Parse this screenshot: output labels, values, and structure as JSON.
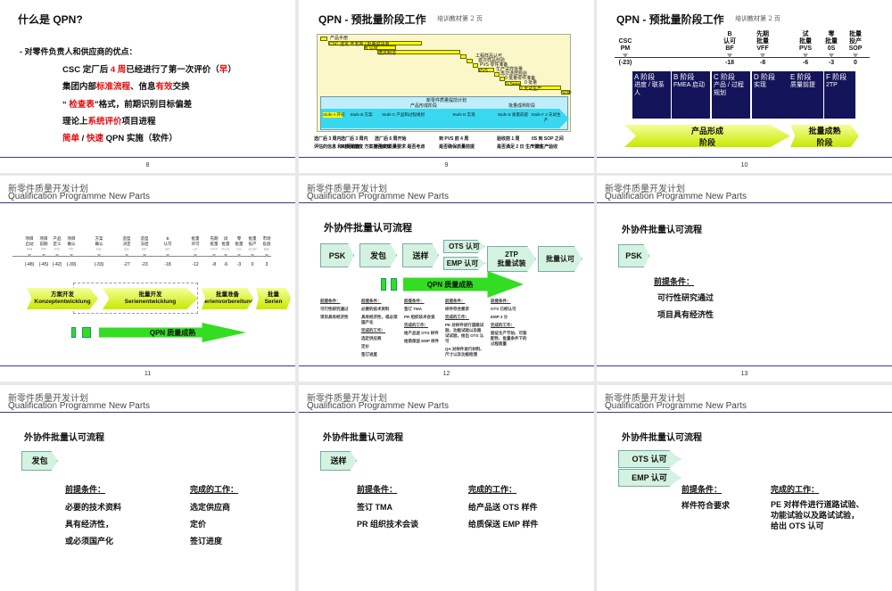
{
  "header": {
    "cn": "新零件质量开发计划",
    "en": "Qualification Programme New Parts"
  },
  "s8": {
    "num": "8",
    "title": "什么是 QPN?",
    "bullet": "-  对零件负责人和供应商的优点：",
    "lines": [
      [
        {
          "t": "CSC 定厂后 "
        },
        {
          "t": "4 周",
          "red": true
        },
        {
          "t": "已经进行了第一次评价（"
        },
        {
          "t": "早",
          "red": true
        },
        {
          "t": "）"
        }
      ],
      [
        {
          "t": "集团内部"
        },
        {
          "t": "标准流程",
          "red": true
        },
        {
          "t": "、信息"
        },
        {
          "t": "有效",
          "red": true
        },
        {
          "t": "交换"
        }
      ],
      [
        {
          "t": "“ "
        },
        {
          "t": "检查表",
          "red": true
        },
        {
          "t": "”格式，前期识别目标偏差"
        }
      ],
      [
        {
          "t": "理论上"
        },
        {
          "t": "系统评价",
          "red": true
        },
        {
          "t": "项目进程"
        }
      ],
      [
        {
          "t": "简单",
          "red": true
        },
        {
          "t": " / "
        },
        {
          "t": "快速",
          "red": true
        },
        {
          "t": " QPN 实施（软件）"
        }
      ]
    ]
  },
  "s9": {
    "num": "9",
    "title": "QPN - 预批量阶段工作",
    "sub": "培训教材第 2 页",
    "gantt": [
      "产品手册",
      "CSC 选定 开发商 / 批量供货商",
      "B 认可",
      "模具制造",
      "工程样品认可",
      "首次样品检验",
      "PVS 零件准备",
      "PVS",
      "生产试样批量",
      "再次送样检验",
      "0 批量零件准备",
      "0-Serie",
      "0 批量",
      "2 天试生产",
      "SOP"
    ],
    "plan": "新零件质量提前计划",
    "phase1": "产品形成阶段",
    "phase2": "批量成熟阶段",
    "stufen": [
      "Stufe A 开同",
      "Stufe B 方案",
      "Stufe C 产品和过程规划",
      "Stufe D 实现",
      "Stufe E 质量前提",
      "Stufe F 2 天试生产"
    ],
    "notes": [
      [
        "选厂后 3 周内",
        "评估的信息 和时间进度"
      ],
      [
        "选厂后 3 周内",
        "从质保角度 方案能否实现"
      ],
      [
        "选厂后 6 周开始",
        "所有的质量要求 是否考虑"
      ],
      [
        "到 PVS 前 4 周",
        "是否确保质量前提"
      ],
      [
        "验收前 1 周",
        "是否满足 2 日 生产要求"
      ],
      [
        "0S 到 SOP 之间",
        "2 日生产验收"
      ]
    ]
  },
  "s10": {
    "num": "10",
    "title": "QPN - 预批量阶段工作",
    "sub": "培训教材第 2 页",
    "milestones": [
      {
        "l": "CSC\nPM",
        "v": "(-23)"
      },
      {
        "l": "B\n认可\nBF",
        "v": "-18"
      },
      {
        "l": "先期\n批量\nVFF",
        "v": "-8"
      },
      {
        "l": "试\n批量\nPVS",
        "v": "-6"
      },
      {
        "l": "零\n批量\n0S",
        "v": "-3"
      },
      {
        "l": "批量\n投产\nSOP",
        "v": "0"
      }
    ],
    "phases": [
      [
        "A 阶段",
        "进度 / 联系人"
      ],
      [
        "B 阶段",
        "FMEA 启动"
      ],
      [
        "C 阶段",
        "产品 / 过程规划"
      ],
      [
        "D 阶段",
        "实现"
      ],
      [
        "E 阶段",
        "质量前提"
      ],
      [
        "F 阶段",
        "2TP"
      ]
    ],
    "arrow1": "产品形成\n阶段",
    "arrow2": "批量成熟\n阶段"
  },
  "s11": {
    "num": "11",
    "milestones": [
      {
        "l": "项目\n启动",
        "c": "PM",
        "v": "(-48)"
      },
      {
        "l": "项目\n前期",
        "c": "PP",
        "v": "(-45)"
      },
      {
        "l": "产品\n定义",
        "c": "PD",
        "v": "(-42)"
      },
      {
        "l": "项目\n确认",
        "c": "PF",
        "v": "(-39)"
      },
      {
        "l": "方案\n确认",
        "c": "KE",
        "v": "(-33)"
      },
      {
        "l": "造型\n决定",
        "c": "DE",
        "v": "-27"
      },
      {
        "l": "造型\n冻结",
        "c": "DF",
        "v": "-23"
      },
      {
        "l": "B\n认可",
        "c": "BF",
        "v": "-18"
      },
      {
        "l": "批量\n许可",
        "c": "LF",
        "v": "-12"
      },
      {
        "l": "先期\n批量",
        "c": "VFF",
        "v": "-8"
      },
      {
        "l": "试\n批量",
        "c": "PVS",
        "v": "-6"
      },
      {
        "l": "零\n批量",
        "c": "0S",
        "v": "-3"
      },
      {
        "l": "批量\n投产",
        "c": "SOP",
        "v": "0"
      },
      {
        "l": "市场\n投放",
        "c": "ME",
        "v": "3"
      }
    ],
    "arrows": [
      "方案开发\nKonzeptentwicklung",
      "批量开发\nSerienentwicklung",
      "批量准备\nSerienvorbereitung",
      "批量\nSerien"
    ],
    "qpn": "QPN 质量成熟"
  },
  "s12": {
    "num": "12",
    "title": "外协件批量认可流程",
    "steps": [
      "PSK",
      "发包",
      "送样",
      "OTS 认可",
      "EMP 认可",
      "2TP\n批量试装",
      "批量认可"
    ],
    "qpn": "QPN 质量成熟",
    "cols": [
      [
        "前提条件：",
        "可行性研究通过",
        "项目具有经济性"
      ],
      [
        "前提条件：",
        "必要的技术资料",
        "具有经济性，或必须国产化",
        "完成的工作：",
        "选定供应商",
        "定价",
        "签订进度"
      ],
      [
        "前提条件：",
        "签订 TMA",
        "PR 组织技术会谈",
        "完成的工作：",
        "给产品送 OTS 样件",
        "给质保送 EMP 样件"
      ],
      [
        "前提条件：",
        "样件符合要求",
        "完成的工作：",
        "PE 对样件进行道路试验、功能试验以及路试试验，给出 OTS 认可",
        "QA 对样件进行材料、尺寸以及功能检测"
      ],
      [
        "前提条件：",
        "OTS 已经认可",
        "EMP 3 分",
        "完成的工作：",
        "验证生产节拍、可装配性、批量条件下的过程质量"
      ]
    ]
  },
  "s13": {
    "num": "13",
    "title": "外协件批量认可流程",
    "step": "PSK",
    "pre": "前提条件：",
    "lines": [
      "可行性研究通过",
      "项目具有经济性"
    ]
  },
  "s14": {
    "title": "外协件批量认可流程",
    "step": "发包",
    "pre": "前提条件：",
    "done": "完成的工作：",
    "pre_lines": [
      "必要的技术资料",
      "具有经济性，",
      "或必须国产化"
    ],
    "done_lines": [
      "选定供应商",
      "定价",
      "签订进度"
    ]
  },
  "s15": {
    "title": "外协件批量认可流程",
    "step": "送样",
    "pre": "前提条件：",
    "done": "完成的工作：",
    "pre_lines": [
      "签订 TMA",
      "PR 组织技术会谈"
    ],
    "done_lines": [
      "给产品送 OTS 样件",
      "给质保送 EMP 样件"
    ]
  },
  "s16": {
    "title": "外协件批量认可流程",
    "steps": [
      "OTS 认可",
      "EMP 认可"
    ],
    "pre": "前提条件：",
    "done": "完成的工作：",
    "pre_lines": [
      "样件符合要求"
    ],
    "done_lines": [
      "PE 对样件进行道路试验、",
      "功能试验以及路试试验，",
      "给出 OTS 认可"
    ]
  }
}
